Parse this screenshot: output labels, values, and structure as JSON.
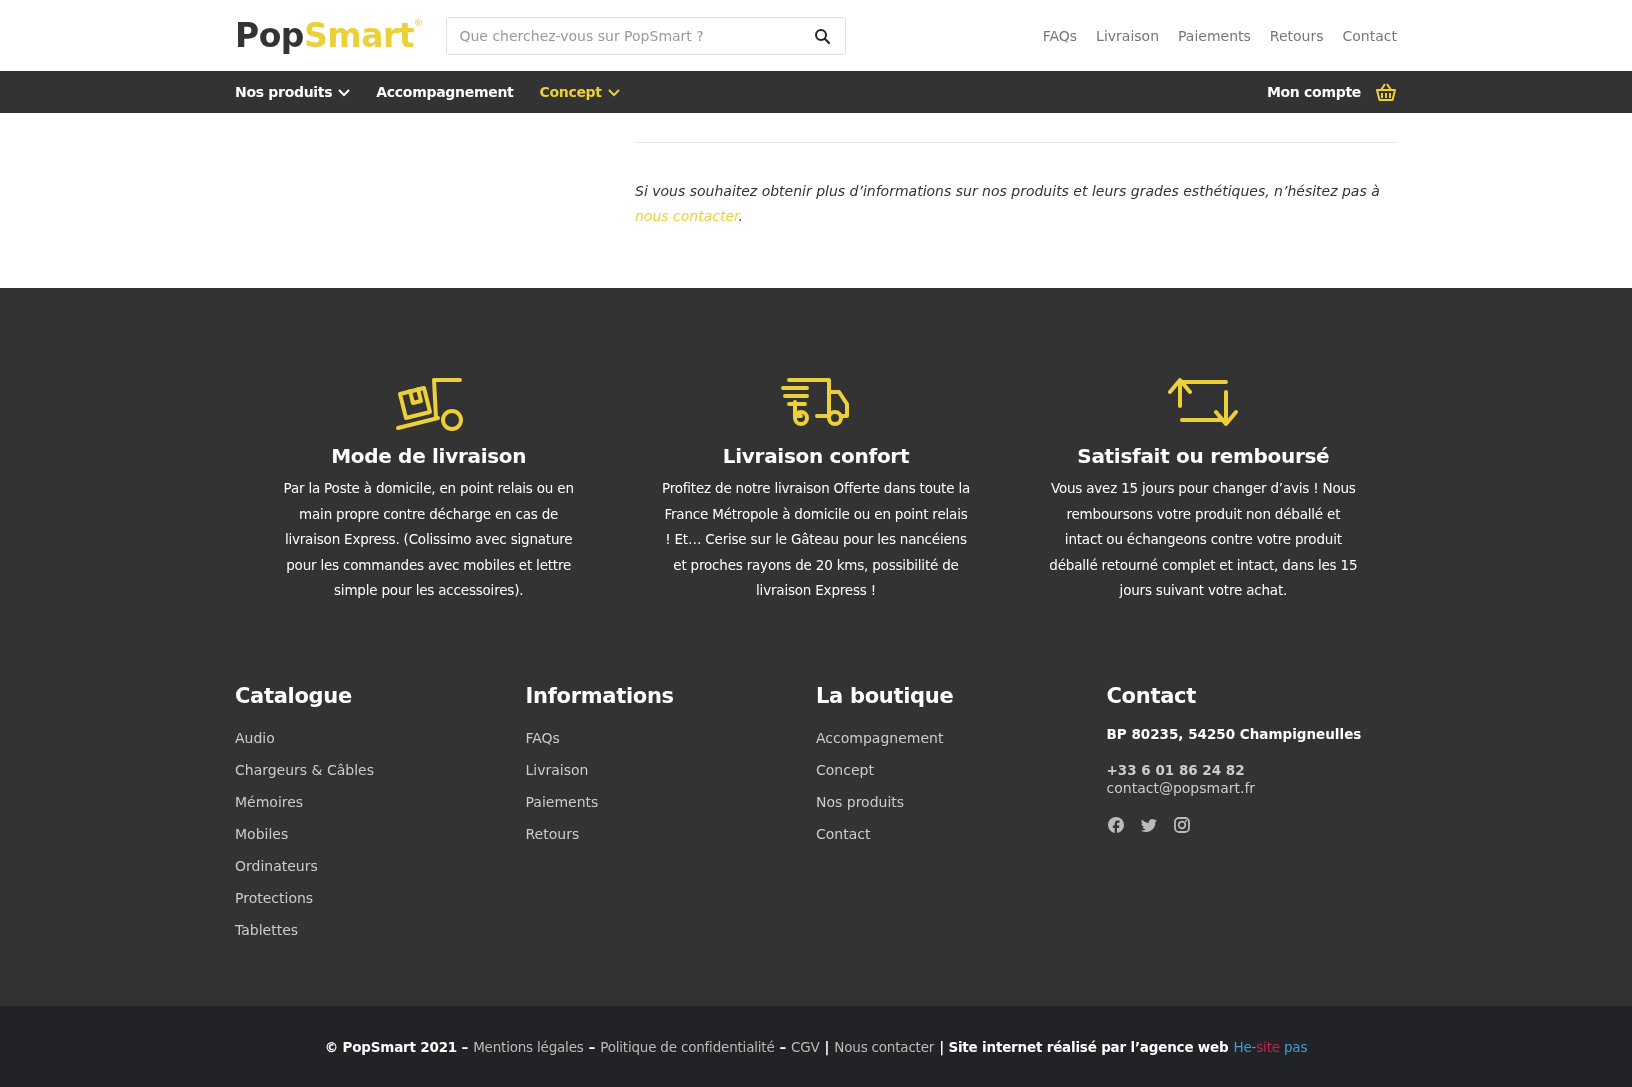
{
  "header": {
    "logo": {
      "dark": "Pop",
      "accent": "Smart",
      "mark": "®"
    },
    "search": {
      "placeholder": "Que cherchez-vous sur PopSmart ?"
    },
    "top_links": [
      "FAQs",
      "Livraison",
      "Paiements",
      "Retours",
      "Contact"
    ]
  },
  "nav": {
    "items": [
      {
        "label": "Nos produits",
        "dropdown": true,
        "selected": false
      },
      {
        "label": "Accompagnement",
        "dropdown": false,
        "selected": false
      },
      {
        "label": "Concept",
        "dropdown": true,
        "selected": true
      }
    ],
    "account": "Mon compte"
  },
  "content": {
    "note": {
      "before": "Si vous souhaitez obtenir plus d’informations sur nos produits et leurs grades esthétiques, n’hésitez pas à ",
      "link": "nous contacter",
      "after": "."
    }
  },
  "features": [
    {
      "kind": "hand-truck",
      "title": "Mode de livraison",
      "text": "Par la Poste à domicile, en point relais ou en main propre contre décharge en cas de livraison Express. (Colissimo avec signature pour les commandes avec mobiles et lettre simple pour les accessoires)."
    },
    {
      "kind": "truck",
      "title": "Livraison confort",
      "text": "Profitez de notre livraison Offerte dans toute la France Métropole à domicile ou en point relais ! Et… Cerise sur le Gâteau pour les nancéiens et proches rayons de 20 kms, possibilité de livraison Express !"
    },
    {
      "kind": "exchange",
      "title": "Satisfait ou remboursé",
      "text": "Vous avez 15 jours pour changer d’avis ! Nous remboursons votre produit non déballé et intact ou échangeons contre votre produit déballé retourné complet et intact, dans les 15 jours suivant votre achat."
    }
  ],
  "footer_columns": [
    {
      "title": "Catalogue",
      "links": [
        "Audio",
        "Chargeurs & Câbles",
        "Mémoires",
        "Mobiles",
        "Ordinateurs",
        "Protections",
        "Tablettes"
      ]
    },
    {
      "title": "Informations",
      "links": [
        "FAQs",
        "Livraison",
        "Paiements",
        "Retours"
      ]
    },
    {
      "title": "La boutique",
      "links": [
        "Accompagnement",
        "Concept",
        "Nos produits",
        "Contact"
      ]
    }
  ],
  "contact": {
    "title": "Contact",
    "address": "BP 80235, 54250 Champigneulles",
    "phone": "+33 6 01 86 24 82",
    "email": "contact@popsmart.fr",
    "social": [
      {
        "kind": "facebook"
      },
      {
        "kind": "twitter"
      },
      {
        "kind": "instagram"
      }
    ]
  },
  "bottom_bar": {
    "parts": [
      {
        "kind": "bold",
        "text": "© PopSmart 2021 –"
      },
      {
        "kind": "link",
        "text": "Mentions légales"
      },
      {
        "kind": "bold",
        "text": "–"
      },
      {
        "kind": "link",
        "text": "Politique de confidentialité"
      },
      {
        "kind": "bold",
        "text": "–"
      },
      {
        "kind": "link",
        "text": "CGV"
      },
      {
        "kind": "bold",
        "text": "|"
      },
      {
        "kind": "link",
        "text": "Nous contacter"
      },
      {
        "kind": "bold",
        "text": "| Site internet réalisé par l’agence web"
      }
    ],
    "agency": [
      {
        "text": "He-",
        "color": "#3aa0d8"
      },
      {
        "text": "site",
        "color": "#c8214f"
      },
      {
        "text": "pas",
        "color": "#3aa0d8"
      }
    ]
  }
}
